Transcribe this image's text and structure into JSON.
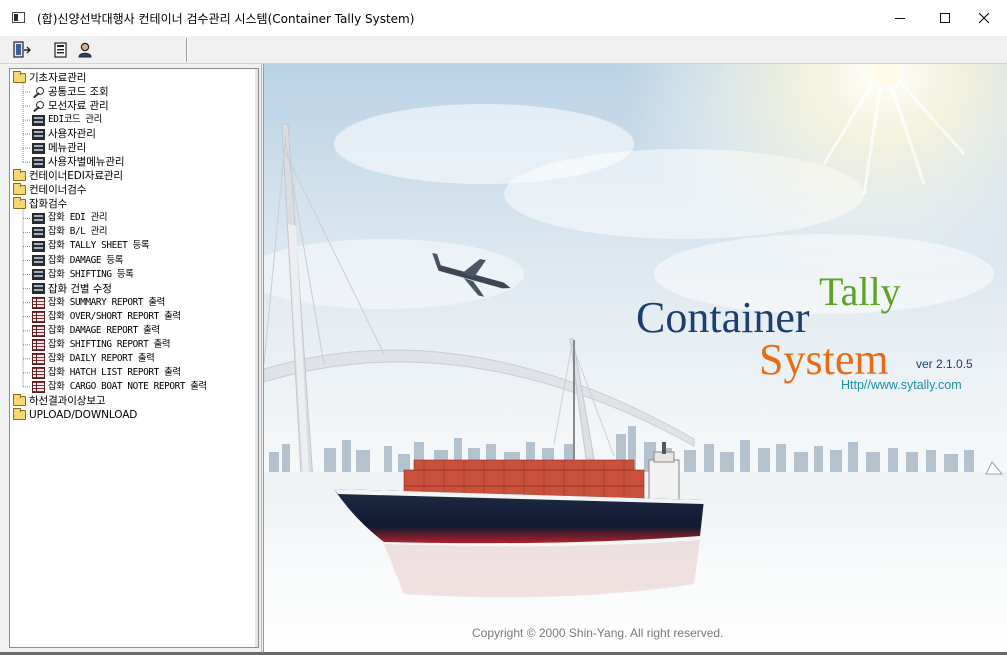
{
  "window": {
    "title": "(합)신양선박대행사 컨테이너 검수관리 시스템(Container Tally System)",
    "minimize_glyph": "—",
    "maximize_glyph": "□",
    "close_glyph": "✕"
  },
  "toolbar": {
    "items": [
      {
        "name": "exit-icon"
      },
      {
        "name": "document-icon"
      },
      {
        "name": "user-icon"
      }
    ]
  },
  "tree": {
    "items": [
      {
        "label": "기초자료관리",
        "icon": "folder-open-icon",
        "level": 0
      },
      {
        "label": "공통코드 조회",
        "icon": "key-icon",
        "level": 1
      },
      {
        "label": "모선자료 관리",
        "icon": "key-icon",
        "level": 1
      },
      {
        "label": "EDI코드 관리",
        "icon": "form-icon",
        "level": 1
      },
      {
        "label": "사용자관리",
        "icon": "form-icon",
        "level": 1
      },
      {
        "label": "메뉴관리",
        "icon": "form-icon",
        "level": 1
      },
      {
        "label": "사용자별메뉴관리",
        "icon": "form-icon",
        "level": 1
      },
      {
        "label": "컨테이너EDI자료관리",
        "icon": "folder-icon",
        "level": 0
      },
      {
        "label": "컨테이너검수",
        "icon": "folder-icon",
        "level": 0
      },
      {
        "label": "잡화검수",
        "icon": "folder-open-icon",
        "level": 0
      },
      {
        "label": "잡화 EDI 관리",
        "icon": "form-icon",
        "level": 1
      },
      {
        "label": "잡화 B/L 관리",
        "icon": "form-icon",
        "level": 1
      },
      {
        "label": "잡화 TALLY SHEET 등록",
        "icon": "form-icon",
        "level": 1
      },
      {
        "label": "잡화 DAMAGE 등록",
        "icon": "form-icon",
        "level": 1
      },
      {
        "label": "잡화 SHIFTING 등록",
        "icon": "form-icon",
        "level": 1
      },
      {
        "label": "잡화 건별 수정",
        "icon": "form-icon",
        "level": 1
      },
      {
        "label": "잡화 SUMMARY REPORT 출력",
        "icon": "report-icon",
        "level": 1
      },
      {
        "label": "잡화 OVER/SHORT REPORT 출력",
        "icon": "report-icon",
        "level": 1
      },
      {
        "label": "잡화 DAMAGE REPORT 출력",
        "icon": "report-icon",
        "level": 1
      },
      {
        "label": "잡화 SHIFTING REPORT 출력",
        "icon": "report-icon",
        "level": 1
      },
      {
        "label": "잡화 DAILY REPORT 출력",
        "icon": "report-icon",
        "level": 1
      },
      {
        "label": "잡화 HATCH LIST REPORT 출력",
        "icon": "report-icon",
        "level": 1
      },
      {
        "label": "잡화 CARGO BOAT NOTE REPORT 출력",
        "icon": "report-icon",
        "level": 1
      },
      {
        "label": "하선결과이상보고",
        "icon": "folder-icon",
        "level": 0
      },
      {
        "label": "UPLOAD/DOWNLOAD",
        "icon": "folder-icon",
        "level": 0
      }
    ]
  },
  "splash": {
    "logo_tally": "Tally",
    "logo_container": "Container",
    "logo_system": "System",
    "version": "ver 2.1.0.5",
    "url": "Http//www.sytally.com",
    "copyright": "Copyright © 2000 Shin-Yang. All right reserved.",
    "colors": {
      "tally": "#5fa122",
      "container": "#1c3f6e",
      "system": "#e66d17",
      "url": "#1c8fa0"
    }
  }
}
